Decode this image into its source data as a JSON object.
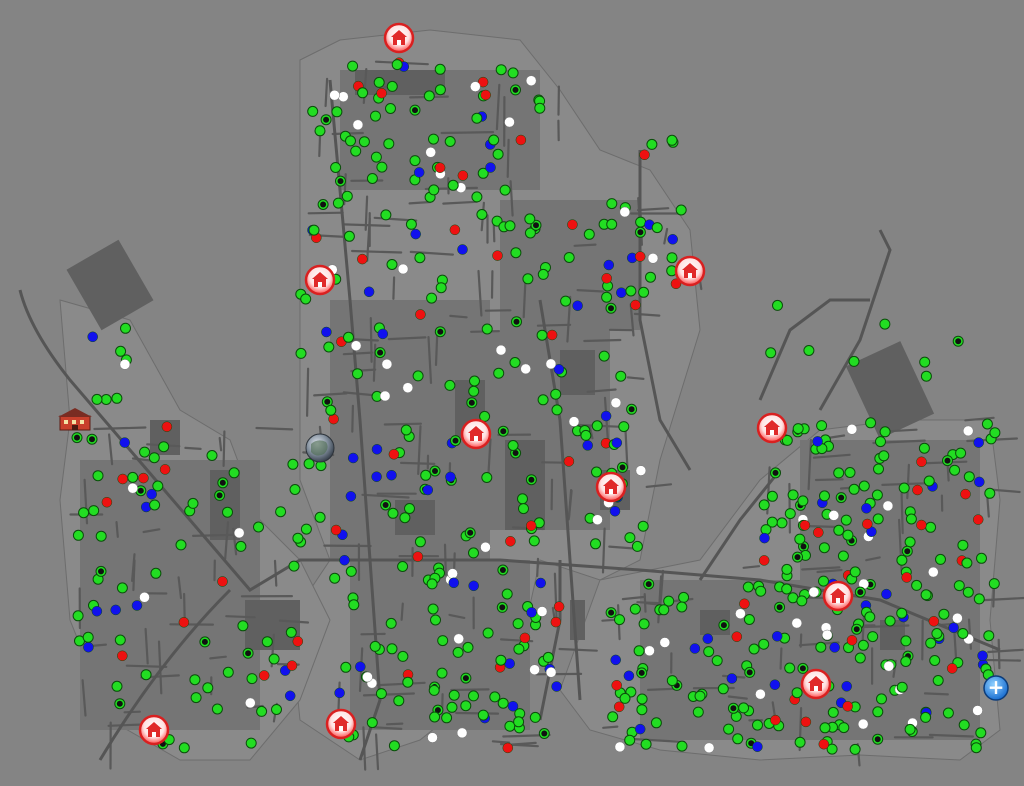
{
  "map": {
    "background_color": "#848484",
    "land_color": "#8e8e8e",
    "road_color": "#5a5a5a",
    "block_color": "#727272",
    "building_color": "#666666"
  },
  "status_colors": {
    "green": "#22dd22",
    "red": "#ee1111",
    "blue": "#1111ee",
    "white": "#ffffff",
    "black": "#111111",
    "gray": "#aaaaaa"
  },
  "icons": {
    "station": "house-pin-icon",
    "hq": "red-building-icon",
    "hospital": "medical-cross-icon",
    "globe": "globe-icon"
  },
  "controls": {
    "hospital_label": "+"
  }
}
